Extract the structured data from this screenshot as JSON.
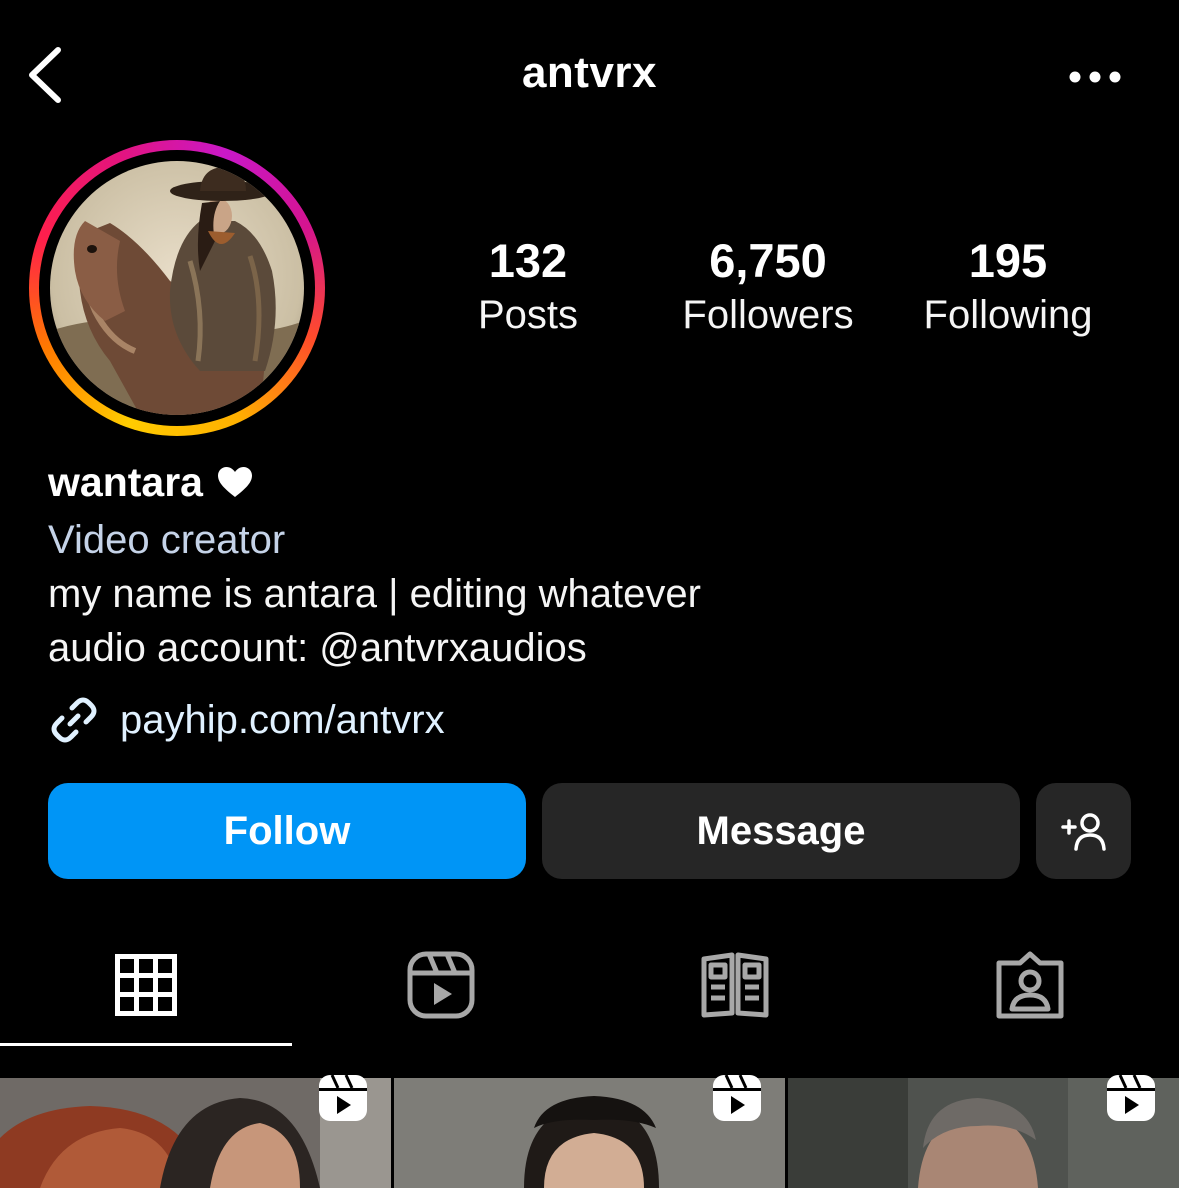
{
  "header": {
    "username": "antvrx",
    "back_icon": "chevron-left-icon",
    "more_icon": "more-horizontal-icon"
  },
  "profile": {
    "avatar_description": "profile-picture",
    "stats": [
      {
        "value": "132",
        "label": "Posts"
      },
      {
        "value": "6,750",
        "label": "Followers"
      },
      {
        "value": "195",
        "label": "Following"
      }
    ],
    "display_name": "wantara",
    "display_name_emoji": "heart-icon",
    "category": "Video creator",
    "bio_lines": [
      "my name is antara | editing whatever",
      "audio account: @antvrxaudios"
    ],
    "link": "payhip.com/antvrx"
  },
  "actions": {
    "follow_label": "Follow",
    "message_label": "Message",
    "suggest_icon": "add-person-icon"
  },
  "tabs": [
    {
      "name": "posts",
      "icon": "grid-icon",
      "active": true
    },
    {
      "name": "reels",
      "icon": "reels-icon",
      "active": false
    },
    {
      "name": "guides",
      "icon": "guide-icon",
      "active": false
    },
    {
      "name": "tagged",
      "icon": "tagged-person-icon",
      "active": false
    }
  ],
  "grid": [
    {
      "type": "reel",
      "icon": "reel-icon"
    },
    {
      "type": "reel",
      "icon": "reel-icon"
    },
    {
      "type": "reel",
      "icon": "reel-icon"
    }
  ],
  "colors": {
    "background": "#000000",
    "follow_button": "#0095f6",
    "secondary_button": "#262626",
    "category_text": "#c5d3e8"
  }
}
